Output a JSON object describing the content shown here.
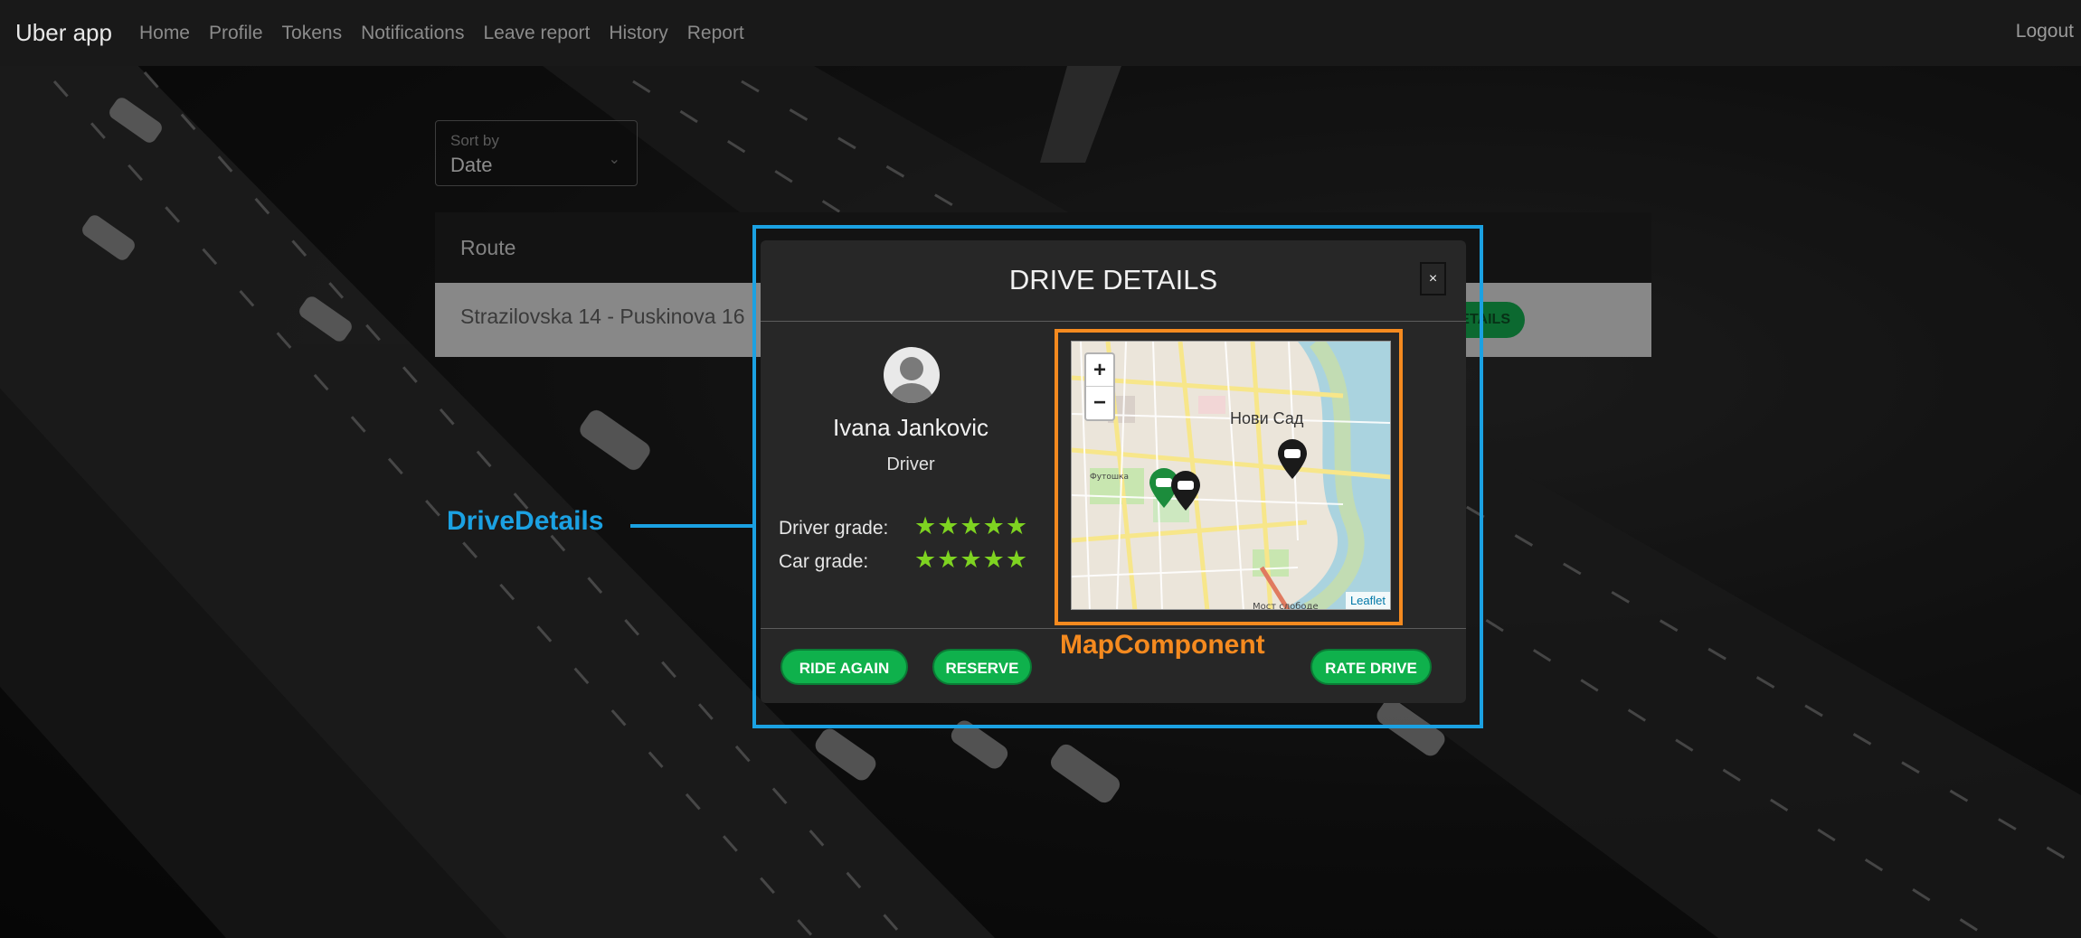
{
  "navbar": {
    "brand": "Uber app",
    "links": [
      "Home",
      "Profile",
      "Tokens",
      "Notifications",
      "Leave report",
      "History",
      "Report"
    ],
    "logout": "Logout"
  },
  "sort": {
    "label": "Sort by",
    "value": "Date"
  },
  "table": {
    "header_route": "Route",
    "row_route": "Strazilovska 14 - Puskinova 16",
    "row_button": "DETAILS"
  },
  "annotations": {
    "drive_details": "DriveDetails",
    "map_component": "MapComponent"
  },
  "modal": {
    "title": "DRIVE DETAILS",
    "close": "×",
    "driver_name": "Ivana Jankovic",
    "driver_role": "Driver",
    "driver_grade_label": "Driver grade:",
    "car_grade_label": "Car grade:",
    "driver_grade": 5,
    "car_grade": 5,
    "stars": "★★★★★",
    "map": {
      "zoom_in": "+",
      "zoom_out": "−",
      "city_label": "Нови Сад",
      "street_label": "Футошка",
      "bridge_label": "Мост слободе",
      "attribution": "Leaflet"
    },
    "buttons": {
      "ride_again": "RIDE AGAIN",
      "reserve": "RESERVE",
      "rate_drive": "RATE DRIVE"
    }
  },
  "colors": {
    "accent_green": "#0fb14c",
    "star_green": "#7ed321",
    "annotation_blue": "#1ba1e2",
    "annotation_orange": "#f58a1f"
  }
}
